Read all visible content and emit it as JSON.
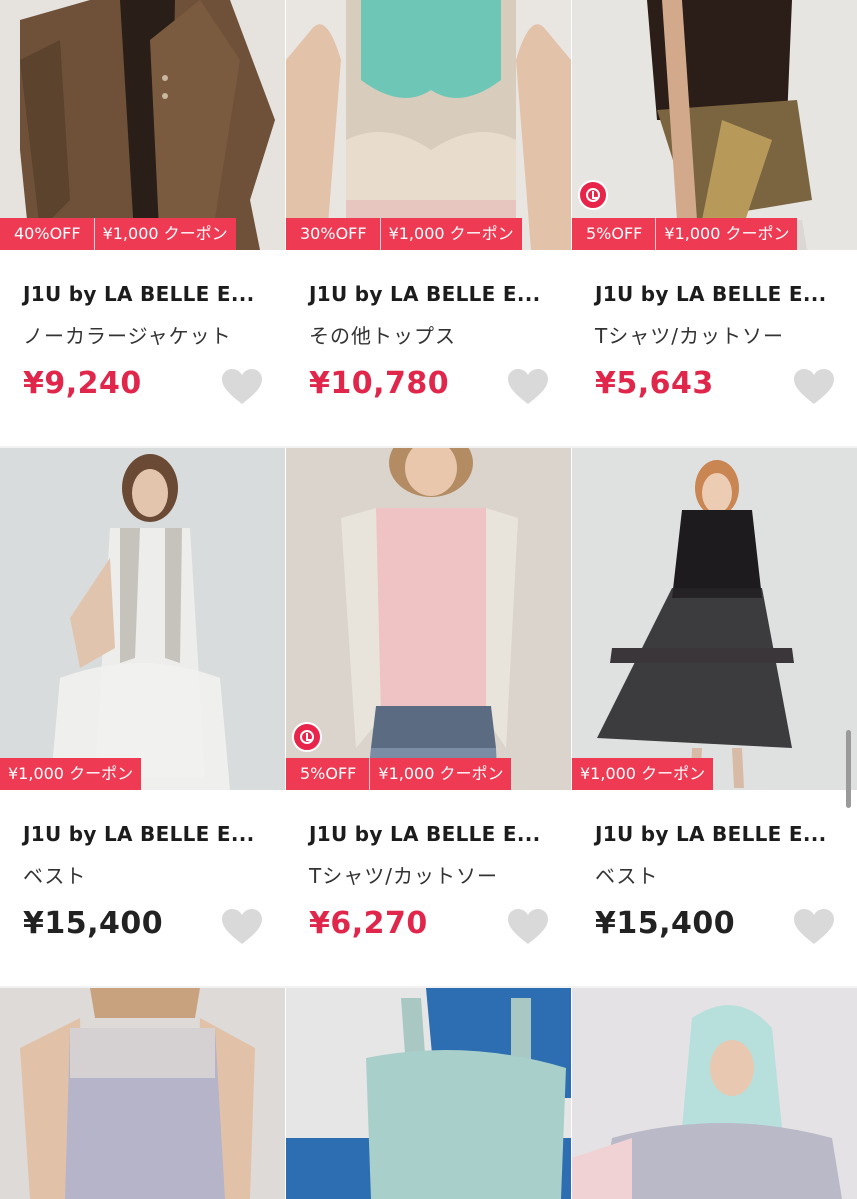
{
  "accent_color": "#ef3a54",
  "price_sale_color": "#e0264a",
  "products": [
    {
      "brand": "J1U by LA BELLE E...",
      "category": "ノーカラージャケット",
      "price": "¥9,240",
      "discount": "40%OFF",
      "coupon": "¥1,000 クーポン",
      "sale": true,
      "timer": false
    },
    {
      "brand": "J1U by LA BELLE E...",
      "category": "その他トップス",
      "price": "¥10,780",
      "discount": "30%OFF",
      "coupon": "¥1,000 クーポン",
      "sale": true,
      "timer": false
    },
    {
      "brand": "J1U by LA BELLE E...",
      "category": "Tシャツ/カットソー",
      "price": "¥5,643",
      "discount": "5%OFF",
      "coupon": "¥1,000 クーポン",
      "sale": true,
      "timer": true
    },
    {
      "brand": "J1U by LA BELLE E...",
      "category": "ベスト",
      "price": "¥15,400",
      "discount": "",
      "coupon": "¥1,000 クーポン",
      "sale": false,
      "timer": false
    },
    {
      "brand": "J1U by LA BELLE E...",
      "category": "Tシャツ/カットソー",
      "price": "¥6,270",
      "discount": "5%OFF",
      "coupon": "¥1,000 クーポン",
      "sale": true,
      "timer": true
    },
    {
      "brand": "J1U by LA BELLE E...",
      "category": "ベスト",
      "price": "¥15,400",
      "discount": "",
      "coupon": "¥1,000 クーポン",
      "sale": false,
      "timer": false
    }
  ],
  "icons": {
    "favorite": "heart-icon",
    "timer": "clock-icon"
  }
}
